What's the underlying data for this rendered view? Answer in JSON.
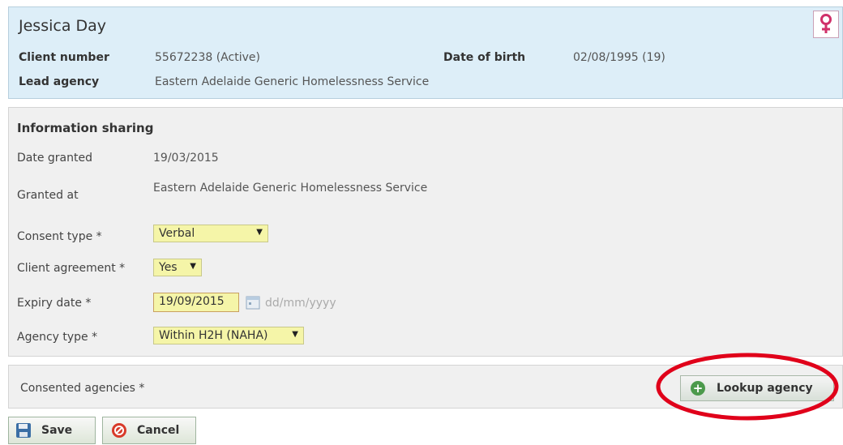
{
  "client": {
    "name": "Jessica Day",
    "client_number_label": "Client number",
    "client_number_value": "55672238 (Active)",
    "dob_label": "Date of birth",
    "dob_value": "02/08/1995 (19)",
    "lead_agency_label": "Lead agency",
    "lead_agency_value": "Eastern Adelaide Generic Homelessness Service",
    "gender_icon": "female-symbol-icon"
  },
  "info": {
    "title": "Information sharing",
    "date_granted_label": "Date granted",
    "date_granted_value": "19/03/2015",
    "granted_at_label": "Granted at",
    "granted_at_value": "Eastern Adelaide Generic Homelessness Service",
    "consent_type_label": "Consent type *",
    "consent_type_value": "Verbal",
    "client_agreement_label": "Client agreement *",
    "client_agreement_value": "Yes",
    "expiry_label": "Expiry date *",
    "expiry_value": "19/09/2015",
    "expiry_format": "dd/mm/yyyy",
    "agency_type_label": "Agency type *",
    "agency_type_value": "Within H2H (NAHA)"
  },
  "agencies": {
    "label": "Consented agencies *",
    "lookup_label": "Lookup agency"
  },
  "actions": {
    "save_label": "Save",
    "cancel_label": "Cancel"
  },
  "colors": {
    "header_bg": "#ddeef8",
    "select_bg": "#f5f5a8",
    "highlight": "#e0001a",
    "female_icon": "#d0306a"
  }
}
